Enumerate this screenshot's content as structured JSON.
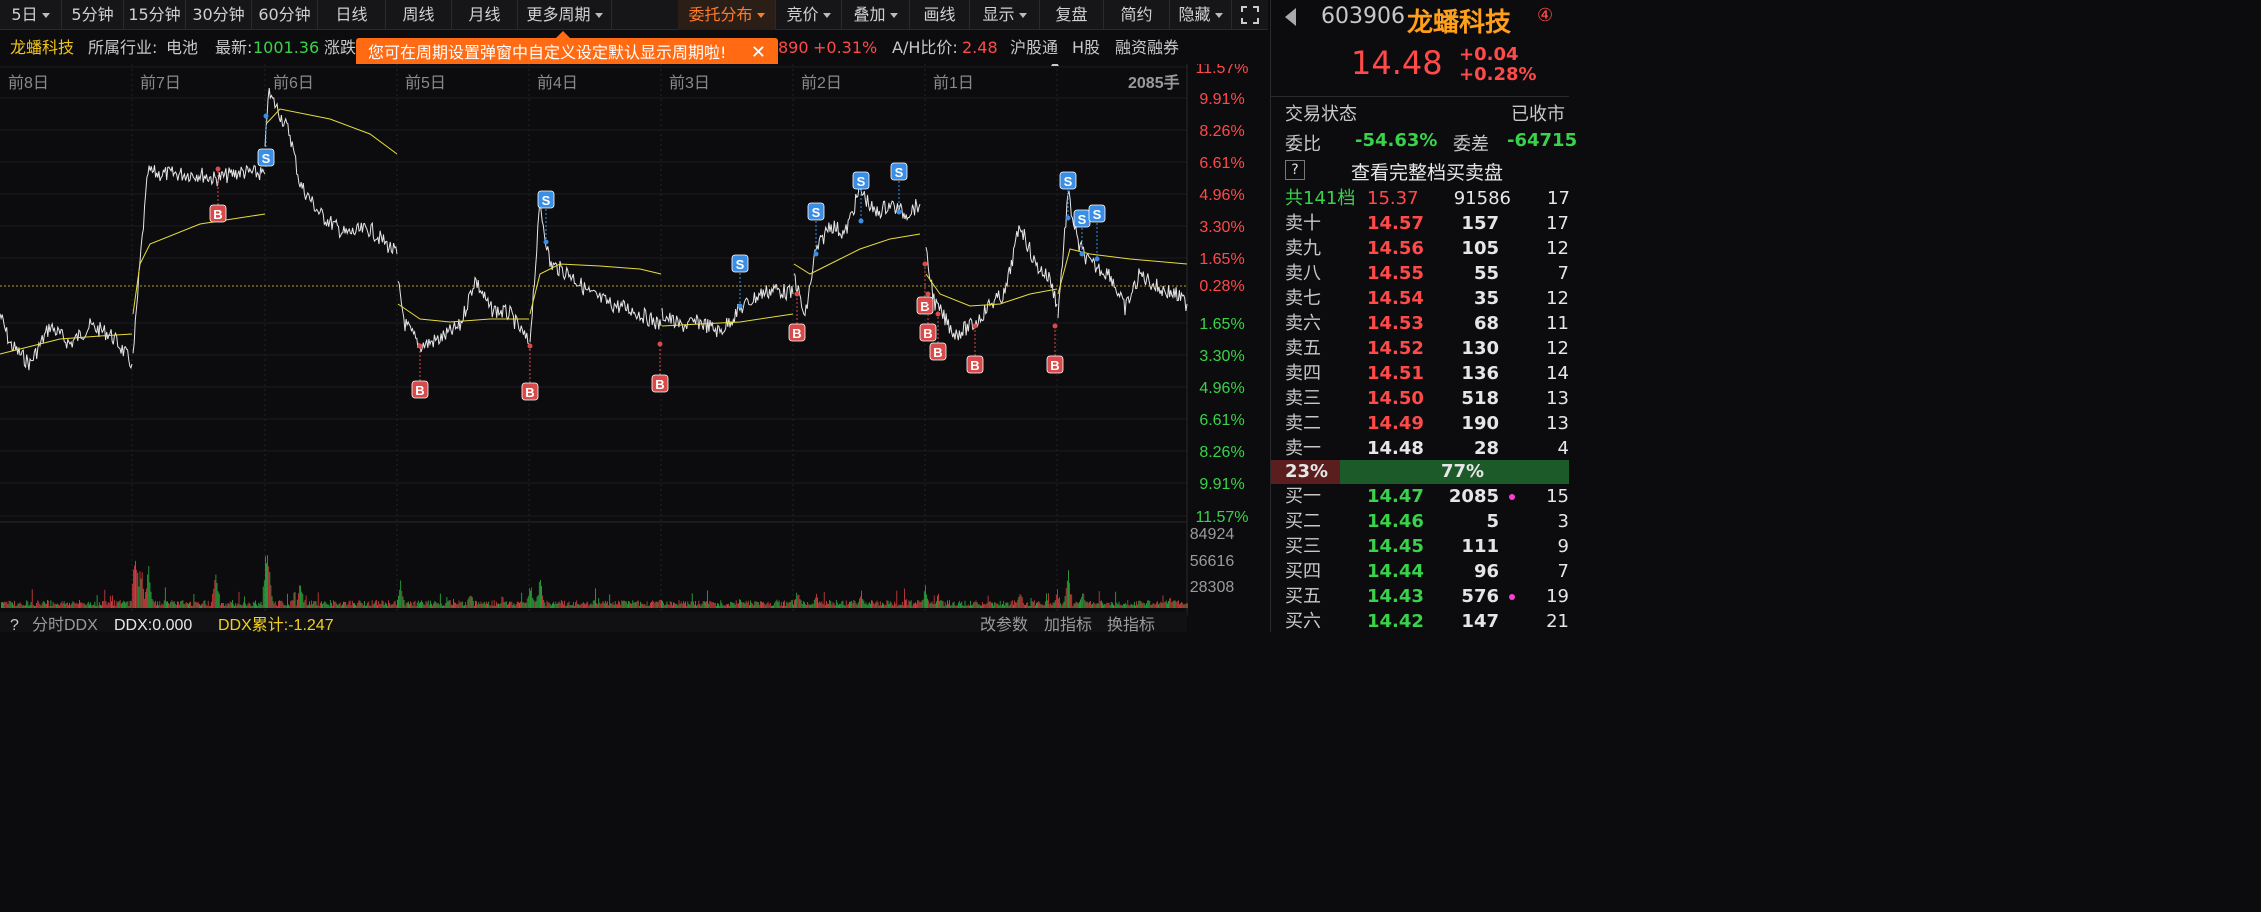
{
  "toolbar": {
    "items": [
      {
        "label": "5日",
        "caret": true
      },
      {
        "label": "5分钟",
        "caret": false
      },
      {
        "label": "15分钟",
        "caret": false
      },
      {
        "label": "30分钟",
        "caret": false
      },
      {
        "label": "60分钟",
        "caret": false
      },
      {
        "label": "日线",
        "caret": false
      },
      {
        "label": "周线",
        "caret": false
      },
      {
        "label": "月线",
        "caret": false
      },
      {
        "label": "更多周期",
        "caret": true
      },
      {
        "label": "委托分布",
        "caret": true,
        "active": true
      },
      {
        "label": "竞价",
        "caret": true
      },
      {
        "label": "叠加",
        "caret": true
      },
      {
        "label": "画线",
        "caret": false
      },
      {
        "label": "显示",
        "caret": true
      },
      {
        "label": "复盘",
        "caret": false
      },
      {
        "label": "简约",
        "caret": false
      },
      {
        "label": "隐藏",
        "caret": true
      }
    ],
    "expand_icon": "expand-icon"
  },
  "info": {
    "name": "龙蟠科技",
    "industry_label": "所属行业:",
    "industry": "电池",
    "latest_label": "最新:",
    "latest": "1001.36",
    "change_label": "涨跌",
    "partial_value": "890",
    "partial_pct": "+0.31%",
    "ah_label": "A/H比价:",
    "ah_value": "2.48",
    "hgt": "沪股通",
    "hshare": "H股",
    "margin": "融资融券"
  },
  "tooltip": {
    "text": "您可在周期设置弹窗中自定义设定默认显示周期啦!",
    "close": "✕"
  },
  "chart": {
    "day_labels": [
      "前8日",
      "前7日",
      "前6日",
      "前5日",
      "前4日",
      "前3日",
      "前2日",
      "前1日"
    ],
    "volume_readout": "2085手",
    "right_axis": [
      "11.57%",
      "9.91%",
      "8.26%",
      "6.61%",
      "4.96%",
      "3.30%",
      "1.65%",
      "0.28%",
      "1.65%",
      "3.30%",
      "4.96%",
      "6.61%",
      "8.26%",
      "9.91%",
      "11.57%"
    ],
    "volume_axis": [
      "84924",
      "56616",
      "28308"
    ],
    "markers": {
      "buy": "B",
      "sell": "S"
    },
    "colors": {
      "price_line": "#e6e6e6",
      "avg_line": "#e6dc3c",
      "up": "#ff4a4a",
      "down": "#39d24a",
      "sell_marker": "#3a8ee6",
      "buy_marker": "#d94a4a"
    }
  },
  "indicator": {
    "help": "?",
    "name": "分时DDX",
    "ddx": "DDX:0.000",
    "ddx_cum": "DDX累计:-1.247",
    "change_params": "改参数",
    "add_indicator": "加指标",
    "switch_indicator": "换指标"
  },
  "panel": {
    "code": "603906",
    "name": "龙蟠科技",
    "badge": "④",
    "price": "14.48",
    "change": "+0.04",
    "change_pct": "+0.28%",
    "trade_status_label": "交易状态",
    "trade_status": "已收市",
    "weibi_label": "委比",
    "weibi": "-54.63%",
    "weicha_label": "委差",
    "weicha": "-64715",
    "full_book_help": "?",
    "full_book_link": "查看完整档买卖盘",
    "total_label": "共141档",
    "total_price": "15.37",
    "total_qty": "91586",
    "total_extra": "17",
    "asks": [
      {
        "label": "卖十",
        "price": "14.57",
        "qty": "157",
        "extra": "17"
      },
      {
        "label": "卖九",
        "price": "14.56",
        "qty": "105",
        "extra": "12"
      },
      {
        "label": "卖八",
        "price": "14.55",
        "qty": "55",
        "extra": "7"
      },
      {
        "label": "卖七",
        "price": "14.54",
        "qty": "35",
        "extra": "12"
      },
      {
        "label": "卖六",
        "price": "14.53",
        "qty": "68",
        "extra": "11"
      },
      {
        "label": "卖五",
        "price": "14.52",
        "qty": "130",
        "extra": "12"
      },
      {
        "label": "卖四",
        "price": "14.51",
        "qty": "136",
        "extra": "14"
      },
      {
        "label": "卖三",
        "price": "14.50",
        "qty": "518",
        "extra": "13"
      },
      {
        "label": "卖二",
        "price": "14.49",
        "qty": "190",
        "extra": "13"
      },
      {
        "label": "卖一",
        "price": "14.48",
        "qty": "28",
        "extra": "4"
      }
    ],
    "ratio_buy": "23%",
    "ratio_sell": "77%",
    "ratio_buy_fraction": 0.23,
    "bids": [
      {
        "label": "买一",
        "price": "14.47",
        "qty": "2085",
        "extra": "15",
        "dot": true
      },
      {
        "label": "买二",
        "price": "14.46",
        "qty": "5",
        "extra": "3",
        "dot": false
      },
      {
        "label": "买三",
        "price": "14.45",
        "qty": "111",
        "extra": "9",
        "dot": false
      },
      {
        "label": "买四",
        "price": "14.44",
        "qty": "96",
        "extra": "7",
        "dot": false
      },
      {
        "label": "买五",
        "price": "14.43",
        "qty": "576",
        "extra": "19",
        "dot": true
      },
      {
        "label": "买六",
        "price": "14.42",
        "qty": "147",
        "extra": "21",
        "dot": false
      }
    ]
  }
}
